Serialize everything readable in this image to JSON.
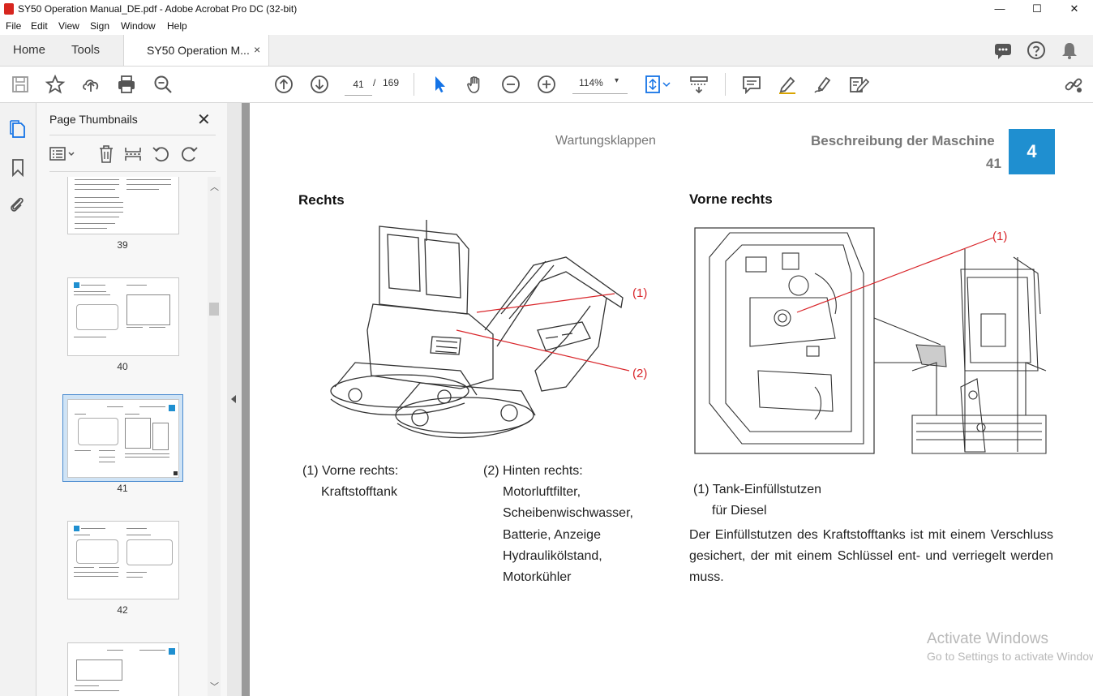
{
  "window": {
    "title": "SY50 Operation Manual_DE.pdf - Adobe Acrobat Pro DC (32-bit)",
    "minimize": "—",
    "maximize": "☐",
    "close": "✕"
  },
  "menu": [
    "File",
    "Edit",
    "View",
    "Sign",
    "Window",
    "Help"
  ],
  "tabs": {
    "home": "Home",
    "tools": "Tools",
    "document": "SY50 Operation M...",
    "close": "×"
  },
  "toolbar": {
    "page_current": "41",
    "page_separator": "/",
    "page_total": "169",
    "zoom": "114%",
    "zoom_caret": "▾"
  },
  "thumbnails": {
    "title": "Page Thumbnails",
    "close": "✕",
    "pages": [
      "39",
      "40",
      "41",
      "42"
    ],
    "selected": "41"
  },
  "page": {
    "header_left": "Wartungsklappen",
    "header_right": "Beschreibung der Maschine",
    "page_number": "41",
    "chapter": "4",
    "left_heading": "Rechts",
    "right_heading": "Vorne rechts",
    "callout_1": "(1)",
    "callout_2": "(2)",
    "callout_r1": "(1)",
    "item1_line1": "(1) Vorne rechts:",
    "item1_line2": "Kraftstofftank",
    "item2_line1": "(2) Hinten rechts:",
    "item2_line2": "Motorluftfilter,",
    "item2_line3": "Scheibenwischwasser,",
    "item2_line4": "Batterie, Anzeige",
    "item2_line5": "Hydraulikölstand,",
    "item2_line6": "Motorkühler",
    "right_item_line1": "(1) Tank-Einfüllstutzen",
    "right_item_line2": "für Diesel",
    "paragraph_line1": "Der Einfüllstutzen des Kraftstofftanks ist mit einem Verschluss",
    "paragraph_line2": "gesichert, der mit einem Schlüssel ent- und verriegelt werden",
    "paragraph_line3": "muss."
  },
  "watermark": {
    "line1": "Activate Windows",
    "line2": "Go to Settings to activate Windows."
  },
  "colors": {
    "chapter_blue": "#1f8fd0",
    "callout_red": "#d9262b",
    "accent": "#1473e6"
  }
}
